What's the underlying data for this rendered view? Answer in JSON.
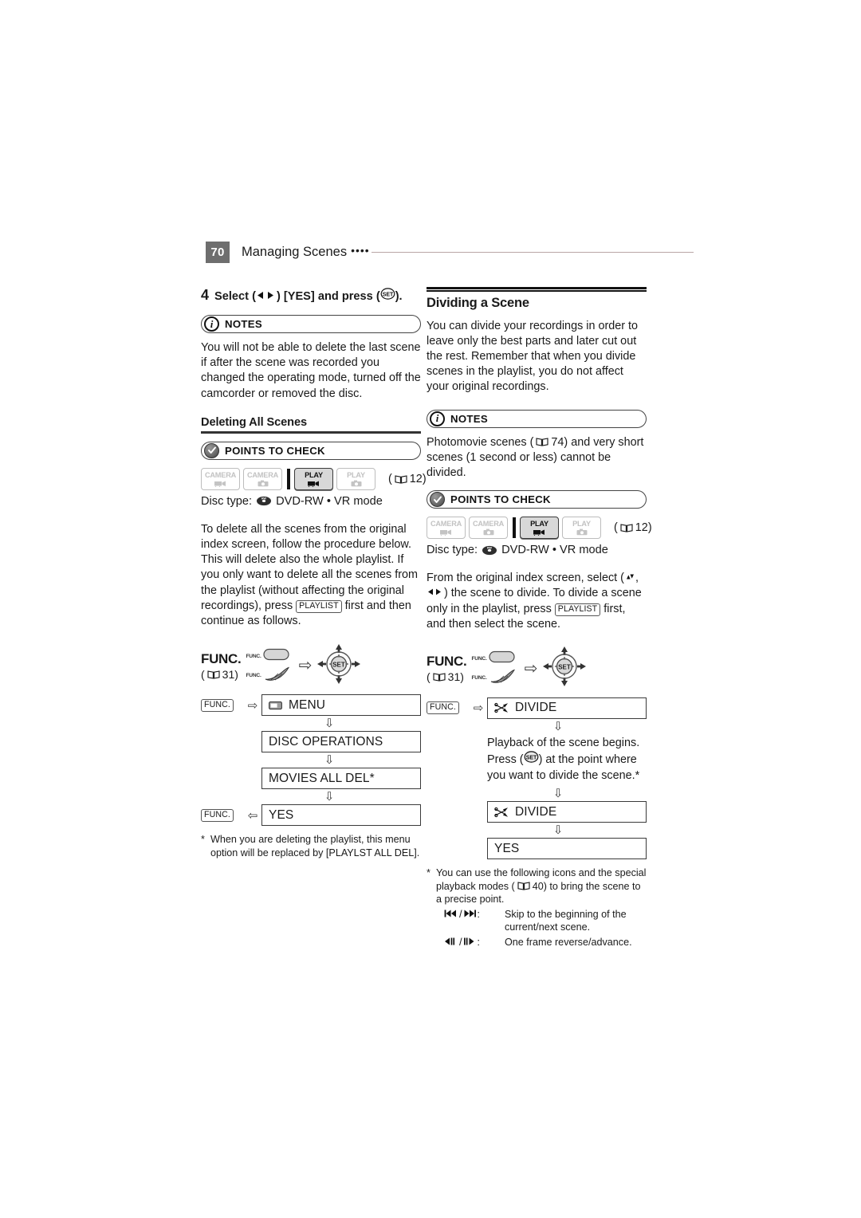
{
  "header": {
    "page_number": "70",
    "title": "Managing Scenes",
    "dots": "••••"
  },
  "left_column": {
    "step4": {
      "number": "4",
      "text_before": "Select (",
      "text_mid": ") [YES] and press (",
      "text_after": ")."
    },
    "notes1": {
      "label": "NOTES",
      "body": "You will not be able to delete the last scene if after the scene was recorded you changed the operating mode, turned off the camcorder or removed the disc."
    },
    "subhead": "Deleting All Scenes",
    "points_to_check": {
      "label": "POINTS TO CHECK"
    },
    "mode_badges": [
      {
        "text": "CAMERA",
        "icon": "movie-camera-icon",
        "active": false
      },
      {
        "text": "CAMERA",
        "icon": "still-camera-icon",
        "active": false
      },
      {
        "text": "PLAY",
        "icon": "movie-camera-icon",
        "active": true
      },
      {
        "text": "PLAY",
        "icon": "still-camera-icon",
        "active": false
      }
    ],
    "mode_ref": "12",
    "disc_type_label": "Disc type:",
    "disc_type_value": "DVD-RW • VR mode",
    "intro": "To delete all the scenes from the original index screen, follow the procedure below. This will delete also the whole playlist. If you only want to delete all the scenes from the playlist (without affecting the original recordings), press",
    "intro_key": "PLAYLIST",
    "intro_tail": "first and then continue as follows.",
    "func": {
      "label": "FUNC.",
      "ref": "31",
      "button_tag": "FUNC.",
      "dial_tag": "FUNC.",
      "set_label": "SET"
    },
    "flow": [
      {
        "key": "FUNC.",
        "icon": "menu-icon",
        "label": "MENU"
      },
      {
        "key": "",
        "icon": "",
        "label": "DISC OPERATIONS"
      },
      {
        "key": "",
        "icon": "",
        "label": "MOVIES ALL DEL*"
      },
      {
        "key": "FUNC.",
        "icon": "",
        "label": "YES",
        "key_side": "left-back"
      }
    ],
    "footnote": {
      "star": "*",
      "body": "When you are deleting the playlist, this menu option will be replaced by [PLAYLST ALL DEL]."
    }
  },
  "right_column": {
    "section_title": "Dividing a Scene",
    "intro": "You can divide your recordings in order to leave only the best parts and later cut out the rest. Remember that when you divide scenes in the playlist, you do not affect your original recordings.",
    "notes": {
      "label": "NOTES",
      "body_before": "Photomovie scenes (",
      "body_ref": "74",
      "body_after": ") and very short scenes (1 second or less) cannot be divided."
    },
    "points_to_check": {
      "label": "POINTS TO CHECK"
    },
    "mode_badges": [
      {
        "text": "CAMERA",
        "icon": "movie-camera-icon",
        "active": false
      },
      {
        "text": "CAMERA",
        "icon": "still-camera-icon",
        "active": false
      },
      {
        "text": "PLAY",
        "icon": "movie-camera-icon",
        "active": true
      },
      {
        "text": "PLAY",
        "icon": "still-camera-icon",
        "active": false
      }
    ],
    "mode_ref": "12",
    "disc_type_label": "Disc type:",
    "disc_type_value": "DVD-RW • VR mode",
    "instruction_1": "From the original index screen, select",
    "instruction_2_mid": ") the scene to divide. To divide a scene only in the playlist, press",
    "instruction_key": "PLAYLIST",
    "instruction_tail": "first, and then select the scene.",
    "func": {
      "label": "FUNC.",
      "ref": "31",
      "button_tag": "FUNC.",
      "dial_tag": "FUNC.",
      "set_label": "SET"
    },
    "flow": [
      {
        "key": "FUNC.",
        "icon": "divide-icon",
        "label": "DIVIDE"
      }
    ],
    "playback_note_1": "Playback of the scene begins.",
    "playback_note_2a": "Press (",
    "playback_note_2b": ") at the point where",
    "playback_note_3": "you want to divide the scene.*",
    "flow2": [
      {
        "icon": "divide-icon",
        "label": "DIVIDE"
      },
      {
        "icon": "",
        "label": "YES"
      }
    ],
    "footnote": {
      "star": "*",
      "body_before": "You can use the following icons and the special playback modes (",
      "body_ref": "40",
      "body_after": ") to bring the scene to a precise point.",
      "rows": [
        {
          "icons": "skip-back-icon / skip-forward-icon",
          "desc": "Skip to the beginning of the current/next scene."
        },
        {
          "icons": "frame-reverse-icon / frame-advance-icon",
          "desc": "One frame reverse/advance."
        }
      ]
    }
  }
}
